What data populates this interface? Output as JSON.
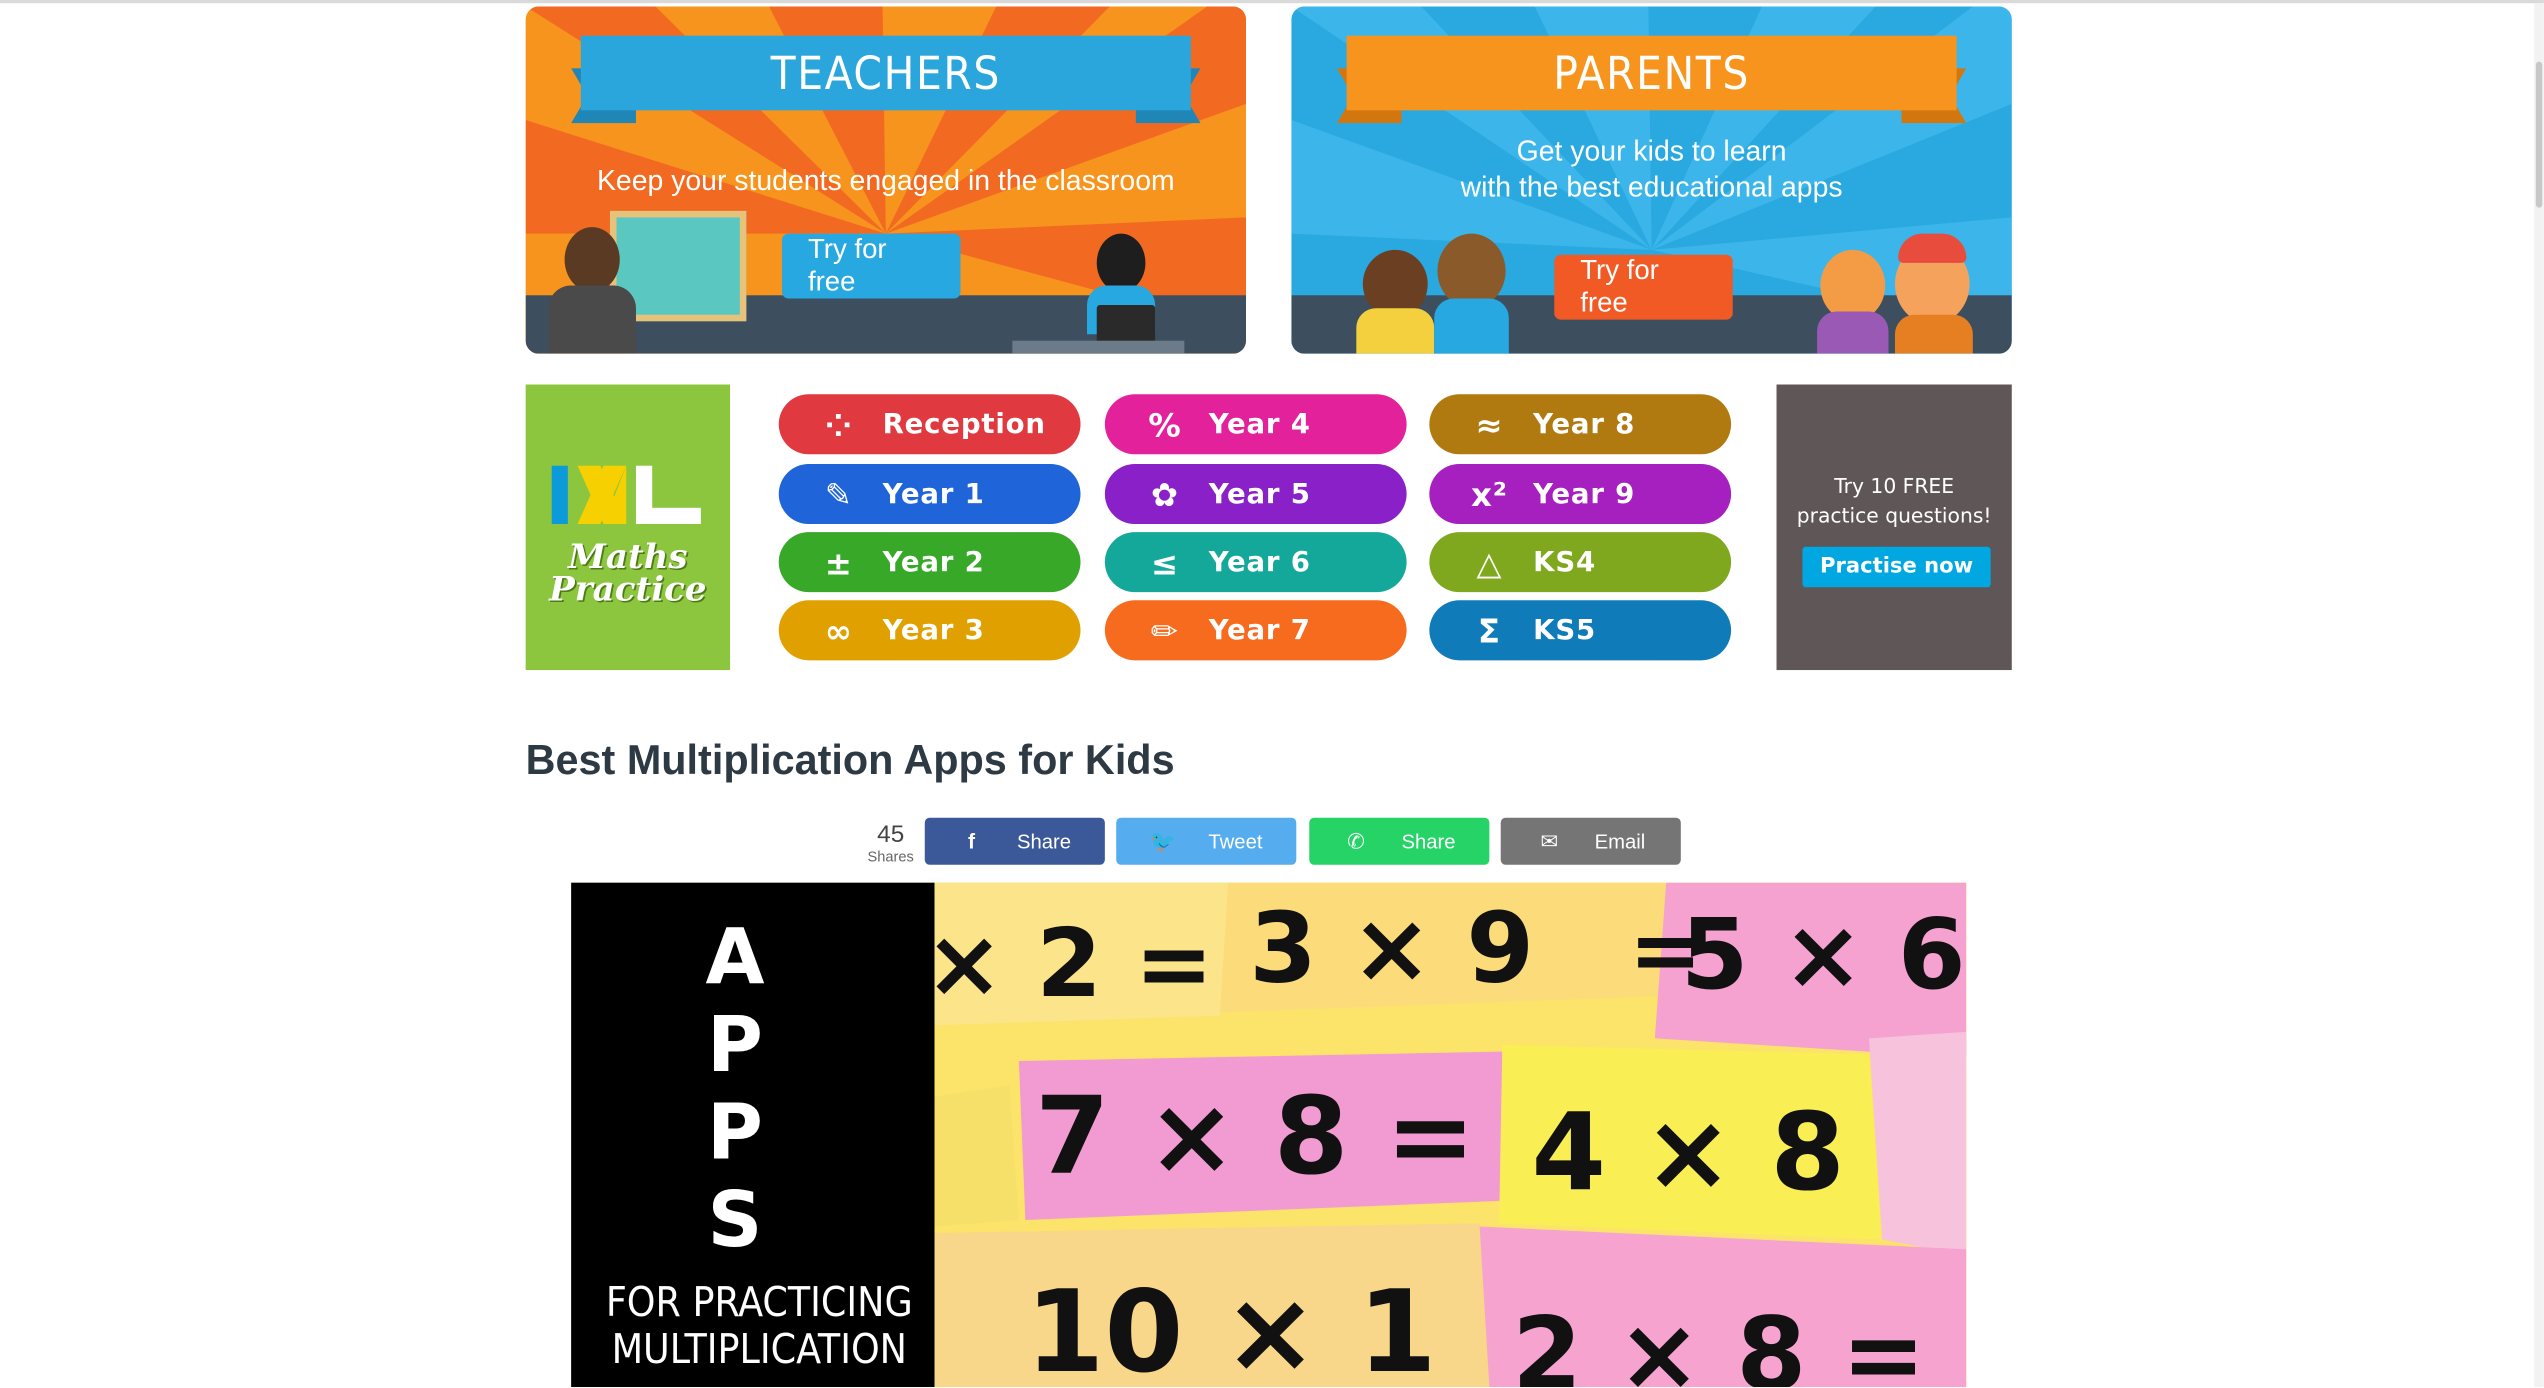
{
  "banners": {
    "teachers": {
      "title": "TEACHERS",
      "subtitle": "Keep your students engaged in the classroom",
      "button": "Try for free"
    },
    "parents": {
      "title": "PARENTS",
      "subtitle_line1": "Get your kids to learn",
      "subtitle_line2": "with the best educational apps",
      "button": "Try for free"
    }
  },
  "ixl": {
    "logo_text": "IXL",
    "tagline_line1": "Maths",
    "tagline_line2": "Practice",
    "grades": [
      {
        "label": "Reception",
        "icon": "dots-icon",
        "glyph": "⁘",
        "color": "#e0393f"
      },
      {
        "label": "Year 1",
        "icon": "pencil-cup-icon",
        "glyph": "✎",
        "color": "#1f64d8"
      },
      {
        "label": "Year 2",
        "icon": "plus-minus-icon",
        "glyph": "±",
        "color": "#38a829"
      },
      {
        "label": "Year 3",
        "icon": "infinity-icon",
        "glyph": "∞",
        "color": "#e0a000"
      },
      {
        "label": "Year 4",
        "icon": "percent-icon",
        "glyph": "%",
        "color": "#e2219b"
      },
      {
        "label": "Year 5",
        "icon": "apple-book-icon",
        "glyph": "✿",
        "color": "#8a20c8"
      },
      {
        "label": "Year 6",
        "icon": "less-equal-icon",
        "glyph": "≤",
        "color": "#13a89a"
      },
      {
        "label": "Year 7",
        "icon": "pencil-icon",
        "glyph": "✏",
        "color": "#f66b1d"
      },
      {
        "label": "Year 8",
        "icon": "approx-icon",
        "glyph": "≈",
        "color": "#b07a10"
      },
      {
        "label": "Year 9",
        "icon": "x-squared-icon",
        "glyph": "x²",
        "color": "#a61fbf"
      },
      {
        "label": "KS4",
        "icon": "triangle-icon",
        "glyph": "△",
        "color": "#7fa81e"
      },
      {
        "label": "KS5",
        "icon": "sigma-icon",
        "glyph": "Σ",
        "color": "#0f7bb8"
      }
    ],
    "free_line1": "Try 10 FREE",
    "free_line2": "practice questions!",
    "practise_button": "Practise now"
  },
  "article": {
    "title": "Best Multiplication Apps for Kids",
    "share_count": "45",
    "share_count_label": "Shares",
    "share_buttons": [
      {
        "label": "Share",
        "icon": "facebook-icon",
        "glyph": "f",
        "color": "#3b5998"
      },
      {
        "label": "Tweet",
        "icon": "twitter-icon",
        "glyph": "🐦",
        "color": "#55acee"
      },
      {
        "label": "Share",
        "icon": "whatsapp-icon",
        "glyph": "✆",
        "color": "#25d366"
      },
      {
        "label": "Email",
        "icon": "email-icon",
        "glyph": "✉",
        "color": "#757575"
      }
    ]
  },
  "hero": {
    "word": "APPS",
    "subtitle_line1": "FOR PRACTICING",
    "subtitle_line2": "MULTIPLICATION",
    "cards": [
      "× 2 =",
      "3 × 9",
      "=",
      "5 × 6",
      "7 × 8 =",
      "4 × 8",
      "10 × 1",
      "2 × 8 ="
    ]
  }
}
